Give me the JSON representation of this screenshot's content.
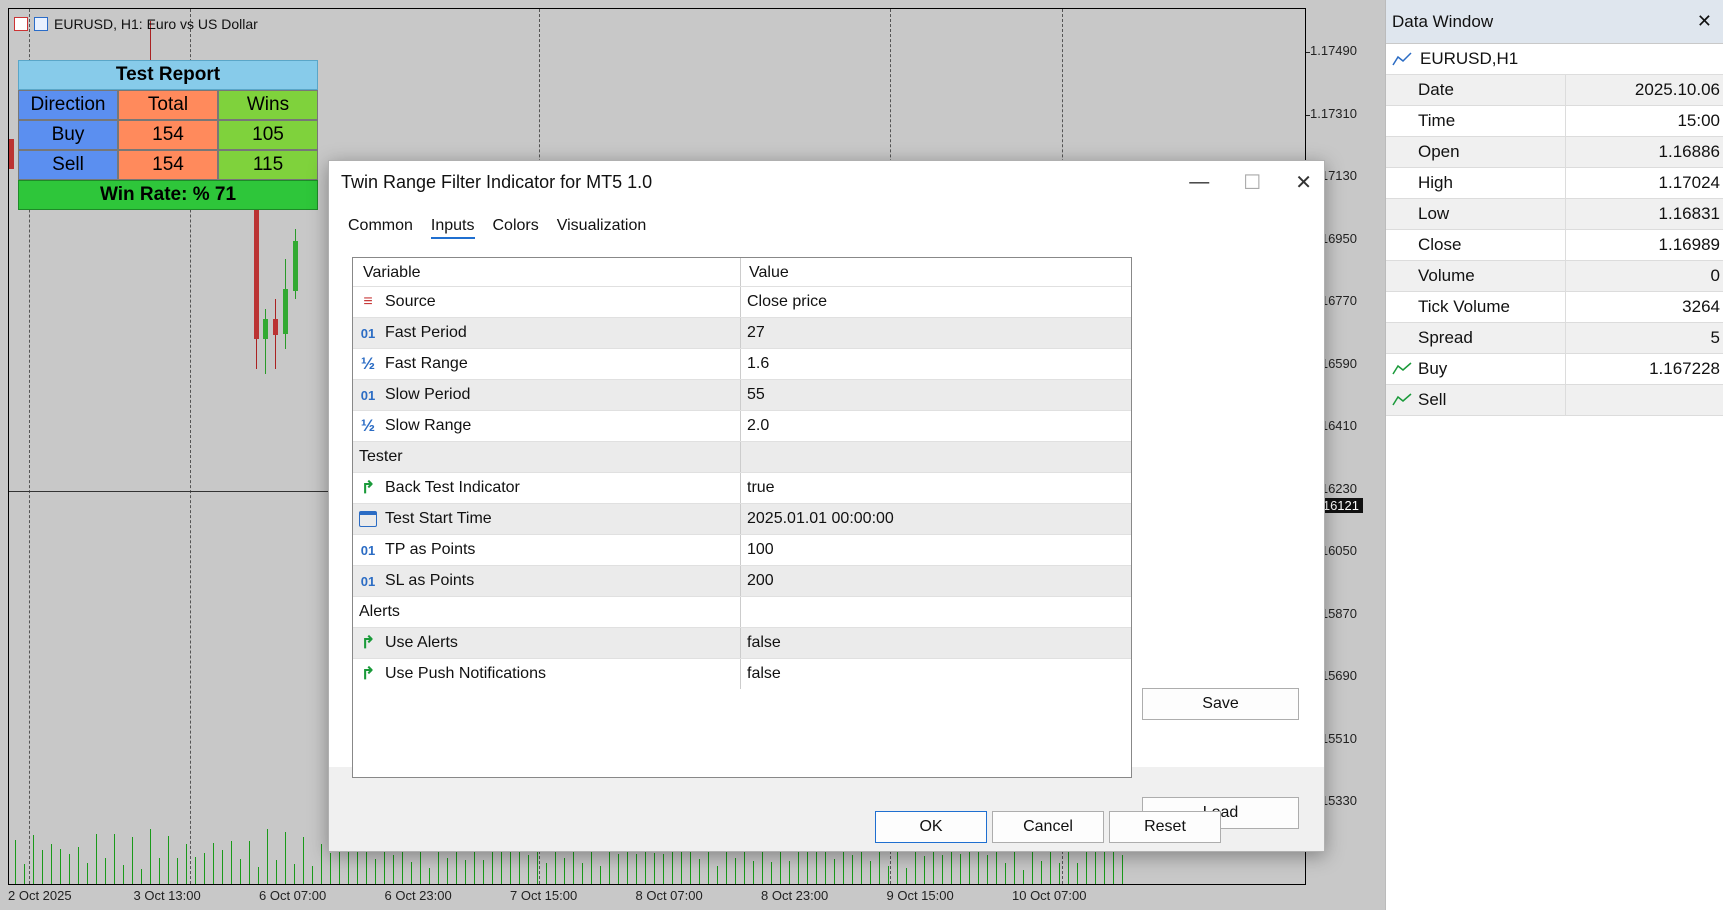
{
  "chart": {
    "title": "EURUSD, H1:  Euro vs US Dollar",
    "price_labels": [
      "1.17490",
      "1.17310",
      "1.17130",
      "1.16950",
      "1.16770",
      "1.16590",
      "1.16410",
      "1.16230",
      "1.16050",
      "1.15870",
      "1.15690",
      "1.15510",
      "1.15330"
    ],
    "current_price": "1.16121",
    "time_labels": [
      "2 Oct 2025",
      "3 Oct 13:00",
      "6 Oct 07:00",
      "6 Oct 23:00",
      "7 Oct 15:00",
      "8 Oct 07:00",
      "8 Oct 23:00",
      "9 Oct 15:00",
      "10 Oct 07:00"
    ]
  },
  "test_report": {
    "title": "Test Report",
    "headers": [
      "Direction",
      "Total",
      "Wins"
    ],
    "rows": [
      {
        "direction": "Buy",
        "total": "154",
        "wins": "105"
      },
      {
        "direction": "Sell",
        "total": "154",
        "wins": "115"
      }
    ],
    "win_rate": "Win Rate: %  71"
  },
  "data_window": {
    "title": "Data Window",
    "close": "✕",
    "symbol": "EURUSD,H1",
    "rows": [
      {
        "name": "Date",
        "value": "2025.10.06"
      },
      {
        "name": "Time",
        "value": "15:00"
      },
      {
        "name": "Open",
        "value": "1.16886"
      },
      {
        "name": "High",
        "value": "1.17024"
      },
      {
        "name": "Low",
        "value": "1.16831"
      },
      {
        "name": "Close",
        "value": "1.16989"
      },
      {
        "name": "Volume",
        "value": "0"
      },
      {
        "name": "Tick Volume",
        "value": "3264"
      },
      {
        "name": "Spread",
        "value": "5"
      }
    ],
    "indicators": [
      {
        "name": "Buy",
        "value": "1.167228"
      },
      {
        "name": "Sell",
        "value": ""
      }
    ]
  },
  "dialog": {
    "title": "Twin Range Filter Indicator for MT5 1.0",
    "tabs": [
      "Common",
      "Inputs",
      "Colors",
      "Visualization"
    ],
    "active_tab": "Inputs",
    "col_variable": "Variable",
    "col_value": "Value",
    "params": [
      {
        "icon": "source-icon",
        "label": "Source",
        "value": "Close price"
      },
      {
        "icon": "integer-icon",
        "label": "Fast Period",
        "value": "27"
      },
      {
        "icon": "double-icon",
        "label": "Fast Range",
        "value": "1.6"
      },
      {
        "icon": "integer-icon",
        "label": "Slow Period",
        "value": "55"
      },
      {
        "icon": "double-icon",
        "label": "Slow Range",
        "value": "2.0"
      },
      {
        "icon": "",
        "label": "Tester",
        "value": ""
      },
      {
        "icon": "bool-icon",
        "label": "Back Test Indicator",
        "value": "true"
      },
      {
        "icon": "calendar-icon",
        "label": "Test Start Time",
        "value": "2025.01.01 00:00:00"
      },
      {
        "icon": "integer-icon",
        "label": "TP as Points",
        "value": "100"
      },
      {
        "icon": "integer-icon",
        "label": "SL as Points",
        "value": "200"
      },
      {
        "icon": "",
        "label": "Alerts",
        "value": ""
      },
      {
        "icon": "bool-icon",
        "label": "Use Alerts",
        "value": "false"
      },
      {
        "icon": "bool-icon",
        "label": "Use Push Notifications",
        "value": "false"
      }
    ],
    "load_label": "Load",
    "save_label": "Save",
    "ok_label": "OK",
    "cancel_label": "Cancel",
    "reset_label": "Reset"
  }
}
